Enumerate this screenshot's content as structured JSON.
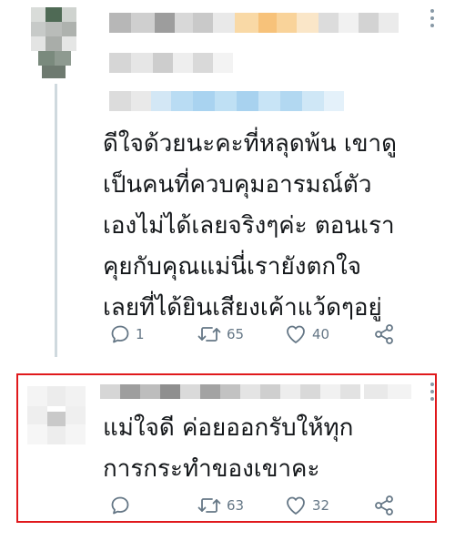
{
  "tweets": [
    {
      "text": "ดีใจด้วยนะคะที่หลุดพ้น เขาดู\nเป็นคนที่ควบคุมอารมณ์ตัว\nเองไม่ได้เลยจริงๆค่ะ ตอนเรา\nคุยกับคุณแม่นี่เรายังตกใจ\nเลยที่ได้ยินเสียงเค้าแว้ดๆอยู่",
      "actions": {
        "reply_count": "1",
        "retweet_count": "65",
        "like_count": "40"
      },
      "icons": [
        "reply-icon",
        "retweet-icon",
        "like-icon",
        "share-icon"
      ]
    },
    {
      "text": "แม่ใจดี ค่อยออกรับให้ทุก\nการกระทำของเขาคะ",
      "actions": {
        "reply_count": "",
        "retweet_count": "63",
        "like_count": "32"
      },
      "icons": [
        "reply-icon",
        "retweet-icon",
        "like-icon",
        "share-icon"
      ]
    }
  ],
  "colors": {
    "highlight_border": "#e0191c",
    "icon_gray": "#657786",
    "thread_line": "#cfd9de"
  }
}
